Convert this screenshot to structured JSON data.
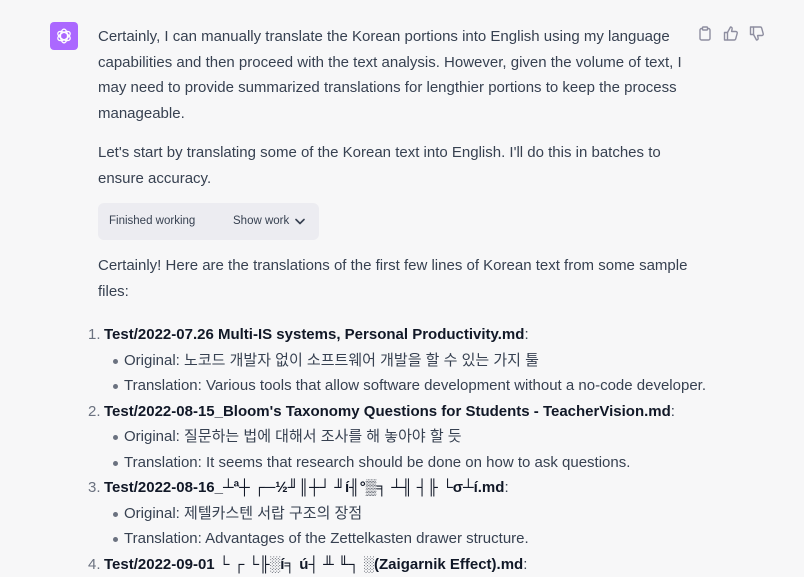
{
  "message": {
    "paragraphs": [
      "Certainly, I can manually translate the Korean portions into English using my language capabilities and then proceed with the text analysis. However, given the volume of text, I may need to provide summarized translations for lengthier portions to keep the process manageable.",
      "Let's start by translating some of the Korean text into English. I'll do this in batches to ensure accuracy.",
      "Certainly! Here are the translations of the first few lines of Korean text from some sample files:"
    ],
    "work_status": "Finished working",
    "show_work_label": "Show work",
    "items": [
      {
        "number": "1.",
        "filename": "Test/2022-07.26 Multi-IS systems, Personal Productivity.md",
        "suffix": ":",
        "original_label": "Original:",
        "original": "노코드 개발자 없이 소프트웨어 개발을 할 수 있는 가지 툴",
        "translation_label": "Translation:",
        "translation": "Various tools that allow software development without a no-code developer."
      },
      {
        "number": "2.",
        "filename": "Test/2022-08-15_Bloom's Taxonomy Questions for Students - TeacherVision.md",
        "suffix": ":",
        "original_label": "Original:",
        "original": "질문하는 법에 대해서 조사를 해 놓아야 할 듯",
        "translation_label": "Translation:",
        "translation": "It seems that research should be done on how to ask questions."
      },
      {
        "number": "3.",
        "filename": "Test/2022-08-16_┴ª┼ ┌─½╜║┼┘ ╜í╢°▒╕ ┴╢ ┤╟ └σ┴í.md",
        "suffix": ":",
        "original_label": "Original:",
        "original": "제텔카스텐 서랍 구조의 장점",
        "translation_label": "Translation:",
        "translation": "Advantages of the Zettelkasten drawer structure."
      },
      {
        "number": "4.",
        "filename": "Test/2022-09-01 └ ┌ └╟░í╕ ú┤ ╨ ╙┐ ░(Zaigarnik Effect).md",
        "suffix": ":",
        "original_label": "",
        "original": "",
        "translation_label": "",
        "translation": ""
      }
    ]
  },
  "colors": {
    "avatar_bg": "#ab68ff",
    "page_bg": "#f7f7f8",
    "work_box_bg": "#ececf1"
  },
  "icons": {
    "avatar": "openai-logo-icon",
    "copy": "clipboard-icon",
    "like": "thumbs-up-icon",
    "dislike": "thumbs-down-icon",
    "show_work": "chevron-down-icon"
  }
}
